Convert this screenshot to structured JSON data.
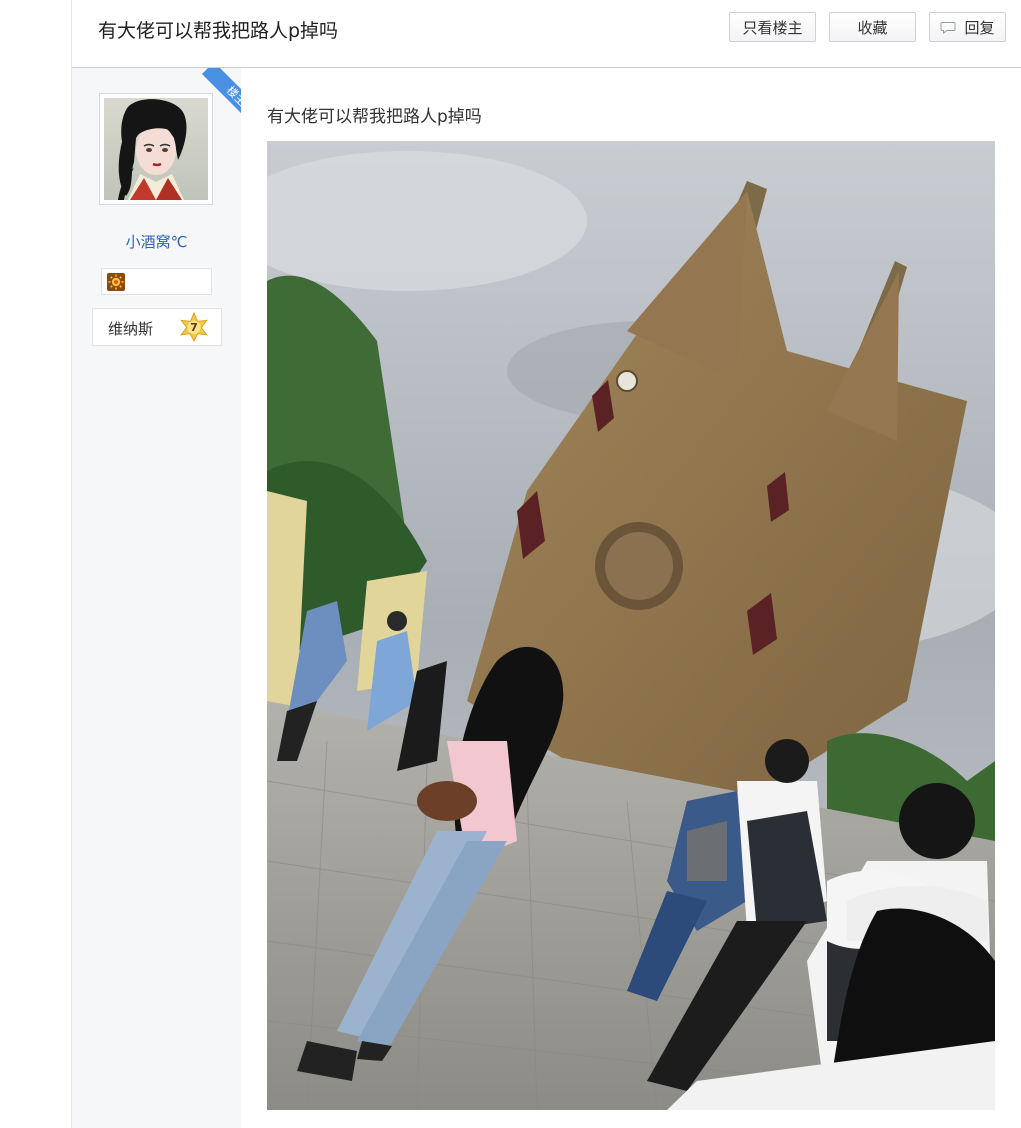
{
  "header": {
    "title": "有大佬可以帮我把路人p掉吗",
    "buttons": {
      "only_op": "只看楼主",
      "favorite": "收藏",
      "reply": "回复"
    },
    "reply_icon": "speech-bubble-icon"
  },
  "author": {
    "op_tag": "楼主",
    "username": "小酒窝℃",
    "badge_icon": "sun-badge-icon",
    "level_name": "维纳斯",
    "level_number": "7",
    "level_icon": "star-level-icon"
  },
  "post": {
    "text": "有大佬可以帮我把路人p掉吗"
  },
  "colors": {
    "accent_blue": "#4a90e2",
    "username_blue": "#2d64b3",
    "sidebar_bg": "#f6f7f9"
  }
}
